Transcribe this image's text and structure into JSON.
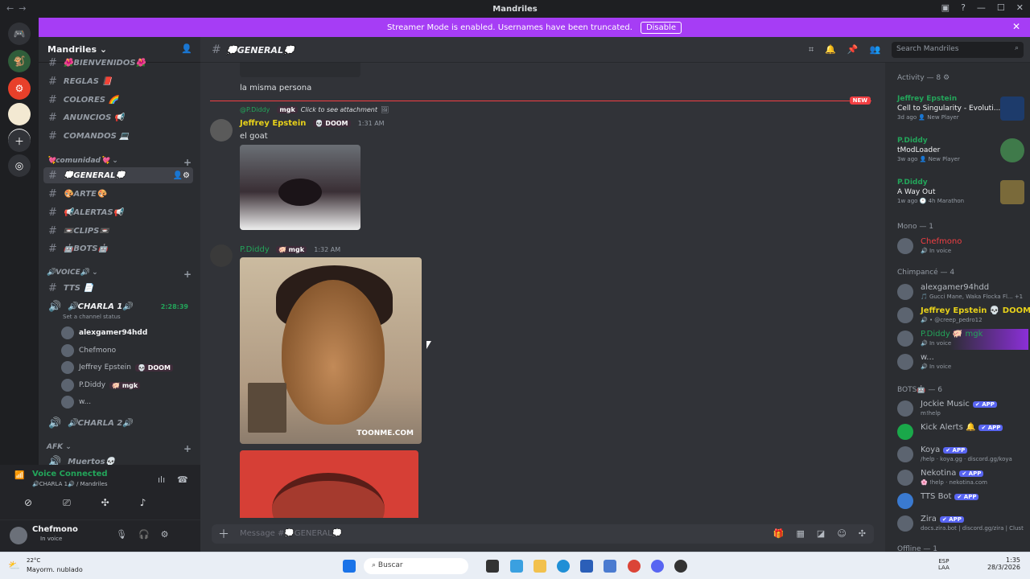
{
  "window": {
    "title": "Mandriles"
  },
  "banner": {
    "text": "Streamer Mode is enabled. Usernames have been truncated.",
    "disable": "Disable"
  },
  "server": {
    "name": "Mandriles"
  },
  "channels": {
    "top": [
      "🌺BIENVENIDOS🌺",
      "REGLAS 📕",
      "COLORES 🌈",
      "ANUNCIOS 📢",
      "COMANDOS 💻"
    ],
    "cat_comunidad": "💘comunidad💘",
    "comunidad": [
      "💭GENERAL💭",
      "🎨ARTE🎨",
      "📢ALERTAS📢",
      "📼CLIPS📼",
      "🤖BOTS🤖"
    ],
    "cat_voice": "🔊VOICE🔊",
    "tts": "TTS 📄",
    "charla1": "🔊CHARLA 1🔊",
    "charla1_time": "2:28:39",
    "charla1_status": "Set a channel status",
    "voice_users": [
      {
        "name": "alexgamer94hdd",
        "badge": ""
      },
      {
        "name": "Chefmono",
        "badge": ""
      },
      {
        "name": "Jeffrey Epstein",
        "badge": "💀 DOOM"
      },
      {
        "name": "P.Diddy",
        "badge": "🐖 mgk"
      },
      {
        "name": "w...",
        "badge": ""
      }
    ],
    "charla2": "🔊CHARLA 2🔊",
    "cat_afk": "AFK",
    "muertos": "Muertos💀"
  },
  "voice_panel": {
    "status": "Voice Connected",
    "channel": "🔊CHARLA 1🔊 / Mandriles"
  },
  "user_panel": {
    "name": "Chefmono",
    "status": "In voice"
  },
  "chat": {
    "channel_title": "💭GENERAL💭",
    "search_placeholder": "Search Mandriles",
    "new_label": "NEW",
    "prev_text": "la misma persona",
    "reply_name": "@P.Diddy",
    "reply_badge": "mgk",
    "reply_text": "Click to see attachment",
    "msg1": {
      "author": "Jeffrey Epstein",
      "badge": "💀 DOOM",
      "time": "1:31 AM",
      "text": "el goat"
    },
    "msg2": {
      "author": "P.Diddy",
      "badge": "🐖 mgk",
      "time": "1:32 AM",
      "watermark": "TOONME.COM"
    },
    "composer_placeholder": "Message #💭GENERAL💭"
  },
  "members": {
    "activity_header": "Activity — 8 ⚙",
    "activities": [
      {
        "user": "Jeffrey Epstein",
        "game": "Cell to Singularity - Evoluti...",
        "meta": "3d ago  👤 New Player"
      },
      {
        "user": "P.Diddy",
        "game": "tModLoader",
        "meta": "3w ago  👤 New Player"
      },
      {
        "user": "P.Diddy",
        "game": "A Way Out",
        "meta": "1w ago  🕐 4h Marathon"
      }
    ],
    "mono_header": "Mono — 1",
    "mono": [
      {
        "name": "Chefmono",
        "sub": "🔊 In voice"
      }
    ],
    "chimp_header": "Chimpancé — 4",
    "chimps": [
      {
        "name": "alexgamer94hdd",
        "sub": "🎵 Gucci Mane, Waka Flocka Fl... +1"
      },
      {
        "name": "Jeffrey Epstein 💀 DOOM",
        "sub": "🔊 • @creep_pedro12"
      },
      {
        "name": "P.Diddy 🐖 mgk",
        "sub": "🔊 In voice"
      },
      {
        "name": "w...",
        "sub": "🔊 In voice"
      }
    ],
    "bots_header": "BOTS🤖 — 6",
    "bots": [
      {
        "name": "Jockie Music",
        "sub": "m!help"
      },
      {
        "name": "Kick Alerts 🔔",
        "sub": ""
      },
      {
        "name": "Koya",
        "sub": "/help · koya.gg · discord.gg/koya"
      },
      {
        "name": "Nekotina",
        "sub": "🌸 !help · nekotina.com"
      },
      {
        "name": "TTS Bot",
        "sub": ""
      },
      {
        "name": "Zira",
        "sub": "docs.zira.bot | discord.gg/zira | Clust"
      }
    ],
    "app_label": "✔ APP",
    "offline_header": "Offline — 1"
  },
  "taskbar": {
    "weather_temp": "22°C",
    "weather_desc": "Mayorm. nublado",
    "search": "Buscar",
    "lang1": "ESP",
    "lang2": "LAA",
    "time": "1:35",
    "date": "28/3/2026"
  }
}
